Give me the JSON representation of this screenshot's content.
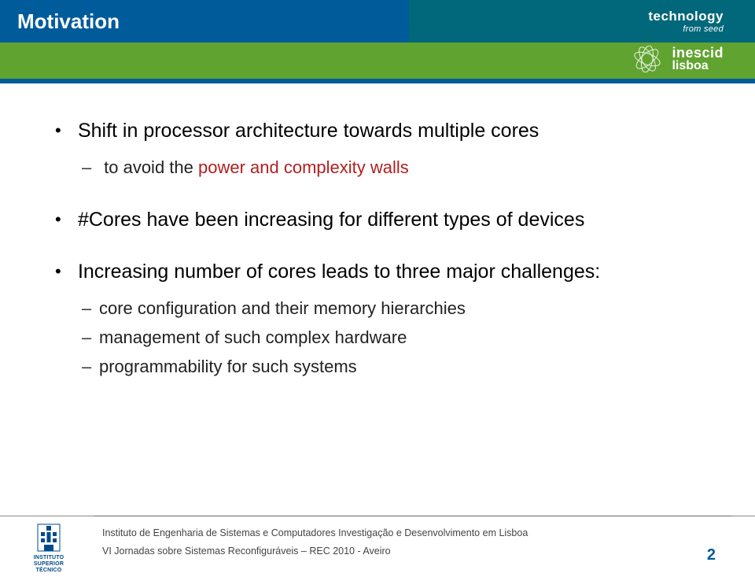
{
  "header": {
    "title": "Motivation",
    "brand_tech": "technology",
    "brand_seed": "from seed",
    "inesc_line1": "inescid",
    "inesc_line2": "lisboa"
  },
  "bullets": {
    "b1_main_pre": "Shift in processor architecture towards multiple cores",
    "b1_sub1_pre": "to avoid the ",
    "b1_sub1_red": "power and complexity walls",
    "b2_main": "#Cores have been increasing for different types of devices",
    "b3_main": "Increasing number of cores leads to three major challenges:",
    "b3_sub1": "core configuration and their memory hierarchies",
    "b3_sub2": "management of such complex hardware",
    "b3_sub3": "programmability for such systems"
  },
  "footer": {
    "ist_l1": "INSTITUTO",
    "ist_l2": "SUPERIOR",
    "ist_l3": "TÉCNICO",
    "line1": "Instituto de Engenharia de Sistemas e Computadores Investigação e Desenvolvimento em Lisboa",
    "line2": "VI Jornadas sobre Sistemas Reconfiguráveis – REC 2010 - Aveiro",
    "page": "2"
  }
}
